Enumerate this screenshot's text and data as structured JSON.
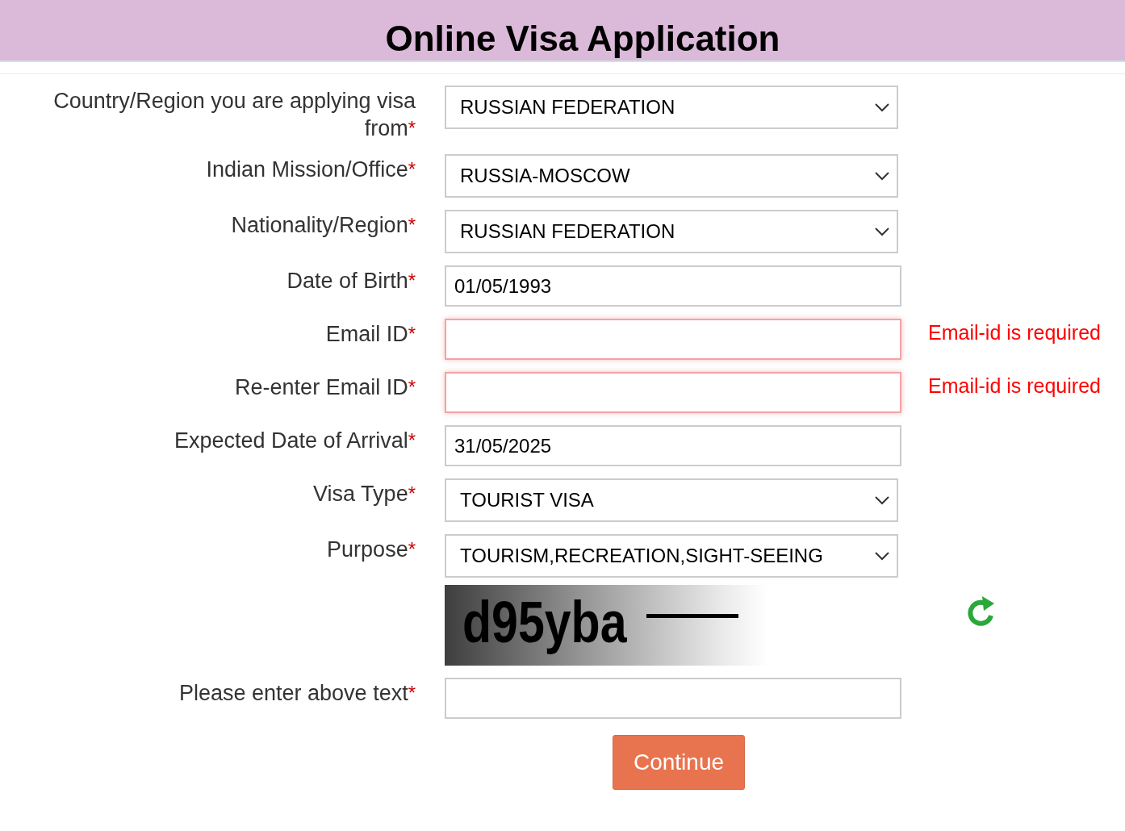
{
  "header": {
    "title": "Online Visa Application"
  },
  "fields": [
    {
      "kind": "select",
      "label": "Country/Region you are applying visa from",
      "required": true,
      "value": "RUSSIAN FEDERATION",
      "invalid": false
    },
    {
      "kind": "select",
      "label": "Indian Mission/Office",
      "required": true,
      "value": "RUSSIA-MOSCOW",
      "invalid": false
    },
    {
      "kind": "select",
      "label": "Nationality/Region",
      "required": true,
      "value": "RUSSIAN FEDERATION",
      "invalid": false
    },
    {
      "kind": "input",
      "label": "Date of Birth",
      "required": true,
      "value": "01/05/1993",
      "invalid": false
    },
    {
      "kind": "input",
      "label": "Email ID",
      "required": true,
      "invalid": true,
      "error": "Email-id is required"
    },
    {
      "kind": "input",
      "label": "Re-enter Email ID",
      "required": true,
      "invalid": true,
      "error": "Email-id is required"
    },
    {
      "kind": "input",
      "label": "Expected Date of Arrival",
      "required": true,
      "value": "31/05/2025",
      "invalid": false
    },
    {
      "kind": "select",
      "label": "Visa Type",
      "required": true,
      "value": "TOURIST VISA",
      "invalid": false
    },
    {
      "kind": "select",
      "label": "Purpose",
      "required": true,
      "value": "TOURISM,RECREATION,SIGHT-SEEING",
      "invalid": false
    },
    {
      "kind": "captcha",
      "text": "d95yba"
    },
    {
      "kind": "input",
      "label": "Please enter above text",
      "required": true,
      "invalid": false
    }
  ],
  "required_mark": "*",
  "continue_button": "Continue"
}
